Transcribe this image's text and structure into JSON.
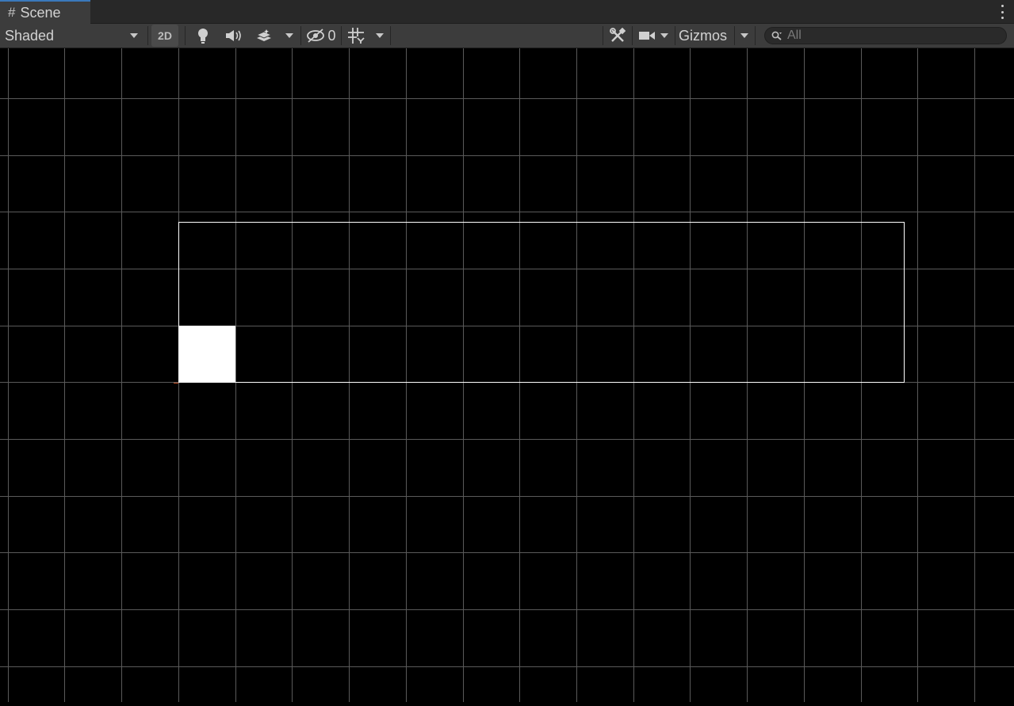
{
  "tab": {
    "title": "Scene"
  },
  "toolbar": {
    "shading_mode": "Shaded",
    "mode_2d_label": "2D",
    "hidden_count": "0",
    "gizmos_label": "Gizmos"
  },
  "search": {
    "placeholder": "All"
  },
  "colors": {
    "background": "#000000",
    "grid_line": "#5a5a5a",
    "camera_bounds": "#ffffff",
    "sprite": "#ffffff",
    "tab_accent": "#3a79bb"
  }
}
